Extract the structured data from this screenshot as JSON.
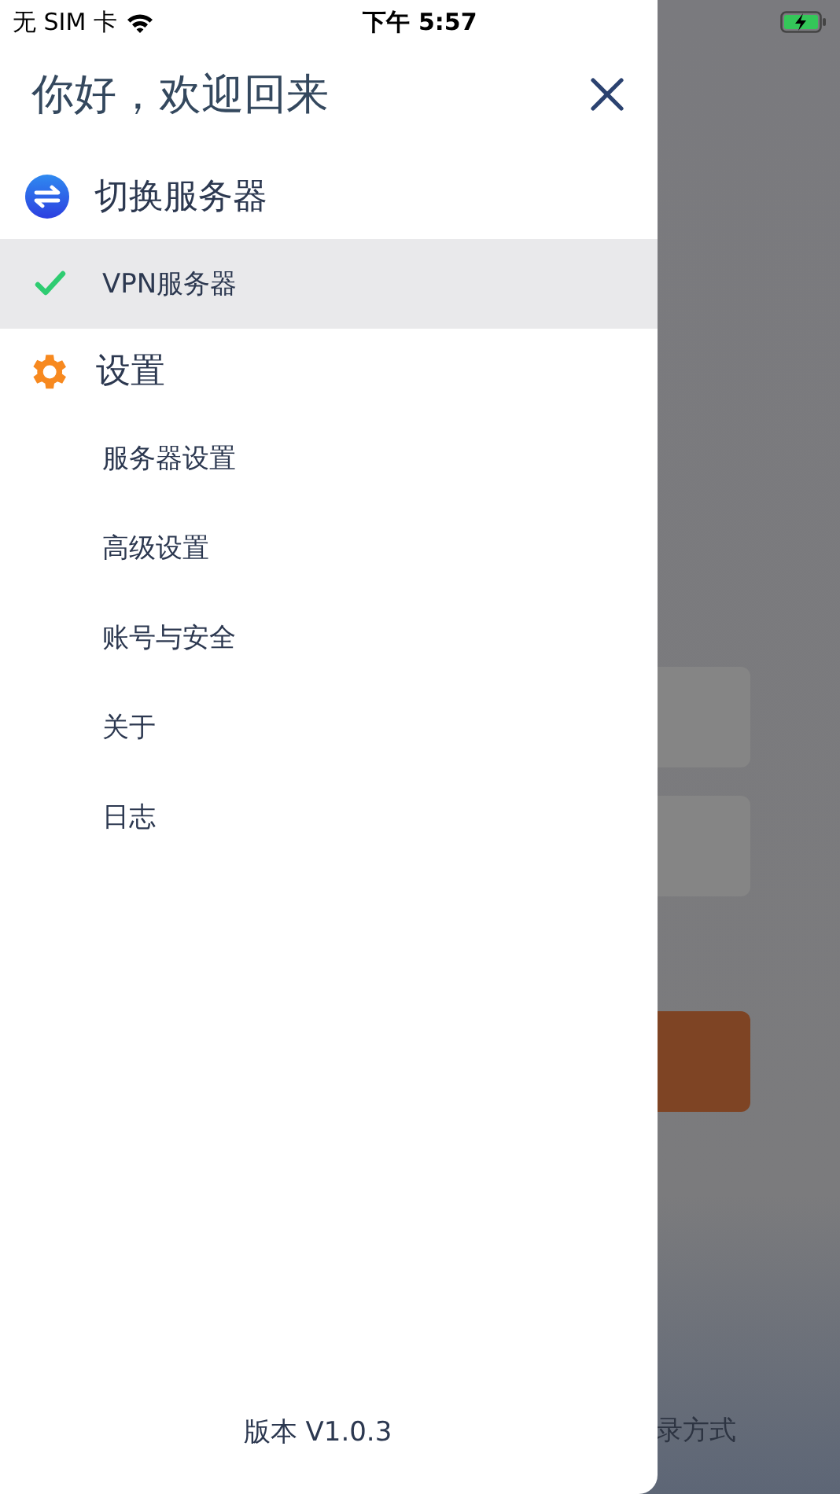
{
  "status_bar": {
    "carrier": "无 SIM 卡",
    "time": "下午 5:57",
    "charging": true
  },
  "background": {
    "footer_text": "录方式"
  },
  "drawer": {
    "greeting": "你好，欢迎回来",
    "sections": [
      {
        "kind": "servers",
        "title": "切换服务器",
        "items": [
          {
            "label": "VPN服务器",
            "selected": true
          }
        ]
      },
      {
        "kind": "settings",
        "title": "设置",
        "items": [
          {
            "label": "服务器设置",
            "selected": false
          },
          {
            "label": "高级设置",
            "selected": false
          },
          {
            "label": "账号与安全",
            "selected": false
          },
          {
            "label": "关于",
            "selected": false
          },
          {
            "label": "日志",
            "selected": false
          }
        ]
      }
    ],
    "version": "版本 V1.0.3"
  }
}
